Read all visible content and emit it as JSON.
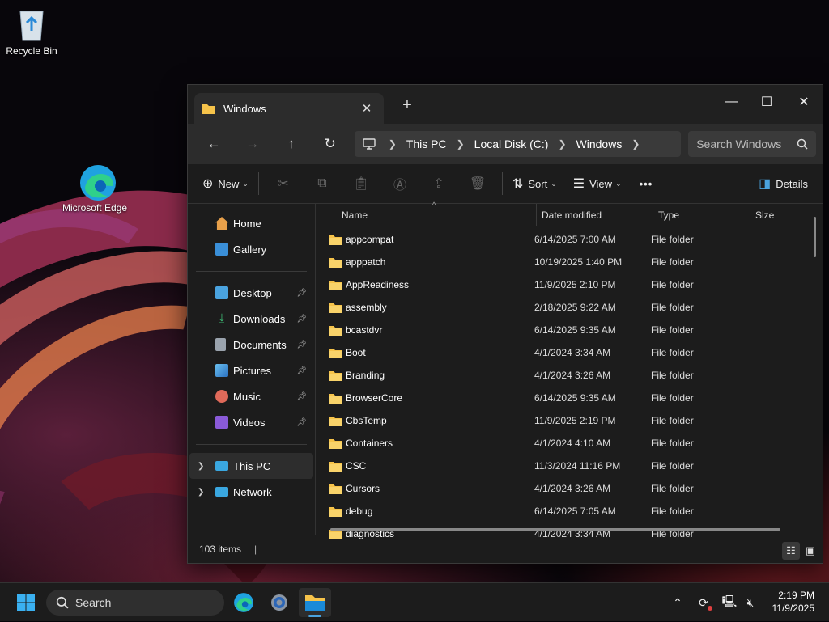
{
  "desktop": {
    "icons": [
      {
        "label": "Recycle Bin",
        "icon": "recycle-bin-icon"
      },
      {
        "label": "Microsoft Edge",
        "icon": "edge-icon"
      }
    ]
  },
  "explorer": {
    "tab_title": "Windows",
    "tab_close": "✕",
    "new_tab": "+",
    "window_controls": {
      "minimize": "—",
      "maximize": "☐",
      "close": "✕"
    },
    "breadcrumb": [
      "This PC",
      "Local Disk (C:)",
      "Windows"
    ],
    "search_placeholder": "Search Windows",
    "toolbar": {
      "new_label": "New",
      "sort_label": "Sort",
      "view_label": "View",
      "more_label": "•••",
      "details_label": "Details"
    },
    "sidebar": {
      "quick": [
        {
          "label": "Home",
          "icon": "home-icon",
          "color": "#e8a04a"
        },
        {
          "label": "Gallery",
          "icon": "gallery-icon",
          "color": "#3a8fd8"
        }
      ],
      "pinned": [
        {
          "label": "Desktop",
          "icon": "desktop-icon",
          "color": "#4aa3df"
        },
        {
          "label": "Downloads",
          "icon": "downloads-icon",
          "color": "#3cb371"
        },
        {
          "label": "Documents",
          "icon": "documents-icon",
          "color": "#9aa3ad"
        },
        {
          "label": "Pictures",
          "icon": "pictures-icon",
          "color": "#3a8fd8"
        },
        {
          "label": "Music",
          "icon": "music-icon",
          "color": "#e06a5a"
        },
        {
          "label": "Videos",
          "icon": "videos-icon",
          "color": "#8a5ad8"
        }
      ],
      "locations": [
        {
          "label": "This PC",
          "icon": "this-pc-icon",
          "color": "#3aa7e0",
          "selected": true
        },
        {
          "label": "Network",
          "icon": "network-icon",
          "color": "#3aa7e0",
          "selected": false
        }
      ]
    },
    "columns": [
      "Name",
      "Date modified",
      "Type",
      "Size"
    ],
    "files": [
      {
        "name": "appcompat",
        "date": "6/14/2025 7:00 AM",
        "type": "File folder"
      },
      {
        "name": "apppatch",
        "date": "10/19/2025 1:40 PM",
        "type": "File folder"
      },
      {
        "name": "AppReadiness",
        "date": "11/9/2025 2:10 PM",
        "type": "File folder"
      },
      {
        "name": "assembly",
        "date": "2/18/2025 9:22 AM",
        "type": "File folder"
      },
      {
        "name": "bcastdvr",
        "date": "6/14/2025 9:35 AM",
        "type": "File folder"
      },
      {
        "name": "Boot",
        "date": "4/1/2024 3:34 AM",
        "type": "File folder"
      },
      {
        "name": "Branding",
        "date": "4/1/2024 3:26 AM",
        "type": "File folder"
      },
      {
        "name": "BrowserCore",
        "date": "6/14/2025 9:35 AM",
        "type": "File folder"
      },
      {
        "name": "CbsTemp",
        "date": "11/9/2025 2:19 PM",
        "type": "File folder"
      },
      {
        "name": "Containers",
        "date": "4/1/2024 4:10 AM",
        "type": "File folder"
      },
      {
        "name": "CSC",
        "date": "11/3/2024 11:16 PM",
        "type": "File folder"
      },
      {
        "name": "Cursors",
        "date": "4/1/2024 3:26 AM",
        "type": "File folder"
      },
      {
        "name": "debug",
        "date": "6/14/2025 7:05 AM",
        "type": "File folder"
      },
      {
        "name": "diagnostics",
        "date": "4/1/2024 3:34 AM",
        "type": "File folder"
      }
    ],
    "status": "103 items"
  },
  "taskbar": {
    "search_label": "Search",
    "time": "2:19 PM",
    "date": "11/9/2025"
  }
}
